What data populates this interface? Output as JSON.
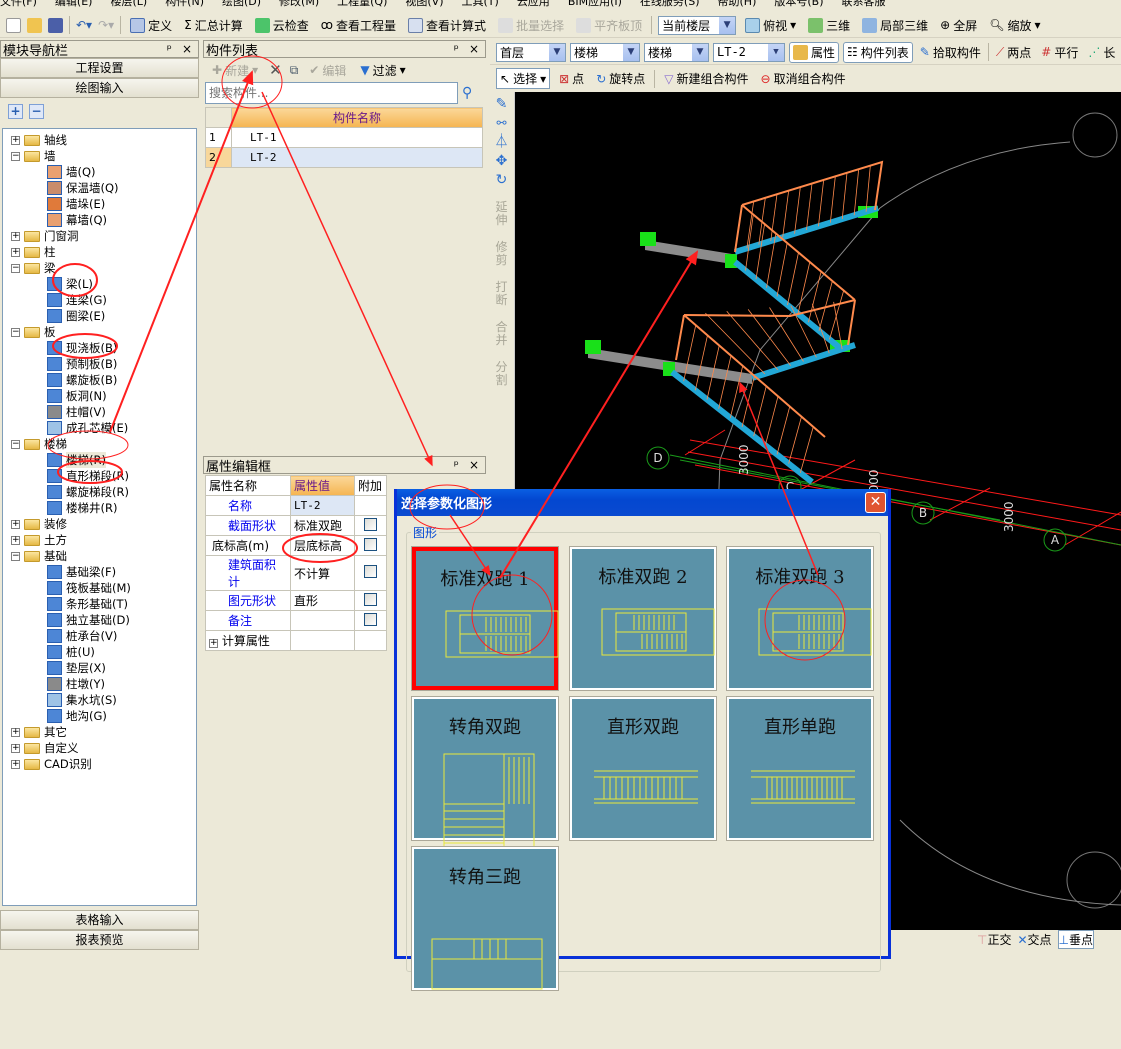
{
  "menu": [
    "文件(F)",
    "编辑(E)",
    "楼层(L)",
    "构件(N)",
    "绘图(D)",
    "修改(M)",
    "工程量(Q)",
    "视图(V)",
    "工具(T)",
    "云应用",
    "BIM应用(I)",
    "在线服务(S)",
    "帮助(H)",
    "版本号(B)",
    "联系客服"
  ],
  "toolbar1": {
    "define": "定义",
    "calc": "汇总计算",
    "cloud_check": "云检查",
    "view_qty": "查看工程量",
    "view_formula": "查看计算式",
    "batch_select": "批量选择",
    "align_top": "平齐板顶",
    "floor_select": "当前楼层",
    "top_view": "俯视",
    "three_d": "三维",
    "partial_3d": "局部三维",
    "fullscreen": "全屏",
    "zoom": "缩放"
  },
  "toolbar2": {
    "floor": "首层",
    "category": "楼梯",
    "type": "楼梯",
    "component": "LT-2",
    "properties": "属性",
    "component_list": "构件列表",
    "pick": "拾取构件",
    "two_points": "两点",
    "parallel": "平行",
    "length": "长"
  },
  "toolbar3": {
    "select": "选择",
    "point": "点",
    "rotate_point": "旋转点",
    "new_group": "新建组合构件",
    "cancel_group": "取消组合构件"
  },
  "vertical_toolbar": [
    "延伸",
    "修剪",
    "打断",
    "合并",
    "分割"
  ],
  "nav": {
    "title": "模块导航栏",
    "project_settings": "工程设置",
    "drawing_input": "绘图输入",
    "table_input": "表格输入",
    "report_preview": "报表预览",
    "tree": [
      {
        "label": "轴线",
        "level": 0,
        "state": "collapsed"
      },
      {
        "label": "墙",
        "level": 0,
        "state": "expanded"
      },
      {
        "label": "墙(Q)",
        "level": 1,
        "color": "#e9a070"
      },
      {
        "label": "保温墙(Q)",
        "level": 1,
        "color": "#c98c6c"
      },
      {
        "label": "墙垛(E)",
        "level": 1,
        "color": "#e07a3a"
      },
      {
        "label": "幕墙(Q)",
        "level": 1,
        "color": "#e9a070"
      },
      {
        "label": "门窗洞",
        "level": 0,
        "state": "collapsed"
      },
      {
        "label": "柱",
        "level": 0,
        "state": "collapsed"
      },
      {
        "label": "梁",
        "level": 0,
        "state": "expanded"
      },
      {
        "label": "梁(L)",
        "level": 1,
        "color": "#4d86d6"
      },
      {
        "label": "连梁(G)",
        "level": 1,
        "color": "#4d86d6"
      },
      {
        "label": "圈梁(E)",
        "level": 1,
        "color": "#4d86d6"
      },
      {
        "label": "板",
        "level": 0,
        "state": "expanded"
      },
      {
        "label": "现浇板(B)",
        "level": 1,
        "color": "#4d86d6"
      },
      {
        "label": "预制板(B)",
        "level": 1,
        "color": "#4d86d6"
      },
      {
        "label": "螺旋板(B)",
        "level": 1,
        "color": "#4d86d6"
      },
      {
        "label": "板洞(N)",
        "level": 1,
        "color": "#4d86d6"
      },
      {
        "label": "柱帽(V)",
        "level": 1,
        "color": "#8a8a8a"
      },
      {
        "label": "成孔芯模(E)",
        "level": 1,
        "color": "#9ec3e6"
      },
      {
        "label": "楼梯",
        "level": 0,
        "state": "expanded"
      },
      {
        "label": "楼梯(R)",
        "level": 1,
        "color": "#4d86d6",
        "selected": true
      },
      {
        "label": "直形梯段(R)",
        "level": 1,
        "color": "#4d86d6"
      },
      {
        "label": "螺旋梯段(R)",
        "level": 1,
        "color": "#4d86d6"
      },
      {
        "label": "楼梯井(R)",
        "level": 1,
        "color": "#4d86d6"
      },
      {
        "label": "装修",
        "level": 0,
        "state": "collapsed"
      },
      {
        "label": "土方",
        "level": 0,
        "state": "collapsed"
      },
      {
        "label": "基础",
        "level": 0,
        "state": "expanded"
      },
      {
        "label": "基础梁(F)",
        "level": 1,
        "color": "#4d86d6"
      },
      {
        "label": "筏板基础(M)",
        "level": 1,
        "color": "#4d86d6"
      },
      {
        "label": "条形基础(T)",
        "level": 1,
        "color": "#4d86d6"
      },
      {
        "label": "独立基础(D)",
        "level": 1,
        "color": "#4d86d6"
      },
      {
        "label": "桩承台(V)",
        "level": 1,
        "color": "#4d86d6"
      },
      {
        "label": "桩(U)",
        "level": 1,
        "color": "#4d86d6"
      },
      {
        "label": "垫层(X)",
        "level": 1,
        "color": "#4d86d6"
      },
      {
        "label": "柱墩(Y)",
        "level": 1,
        "color": "#8a8a8a"
      },
      {
        "label": "集水坑(S)",
        "level": 1,
        "color": "#9ec3e6"
      },
      {
        "label": "地沟(G)",
        "level": 1,
        "color": "#4d86d6"
      },
      {
        "label": "其它",
        "level": 0,
        "state": "collapsed"
      },
      {
        "label": "自定义",
        "level": 0,
        "state": "collapsed"
      },
      {
        "label": "CAD识别",
        "level": 0,
        "state": "collapsed"
      }
    ]
  },
  "component_list": {
    "title": "构件列表",
    "new": "新建",
    "edit": "编辑",
    "filter": "过滤",
    "search_placeholder": "搜索构件...",
    "column": "构件名称",
    "rows": [
      {
        "index": "1",
        "name": "LT-1"
      },
      {
        "index": "2",
        "name": "LT-2",
        "selected": true
      }
    ]
  },
  "property_editor": {
    "title": "属性编辑框",
    "headers": [
      "属性名称",
      "属性值",
      "附加"
    ],
    "rows": [
      {
        "name": "名称",
        "value": "LT-2",
        "blue": true,
        "checkbox": false
      },
      {
        "name": "截面形状",
        "value": "标准双跑",
        "blue": true,
        "checkbox": true
      },
      {
        "name": "底标高(m)",
        "value": "层底标高",
        "blue": false,
        "checkbox": true
      },
      {
        "name": "建筑面积计",
        "value": "不计算",
        "blue": true,
        "checkbox": true
      },
      {
        "name": "图元形状",
        "value": "直形",
        "blue": true,
        "checkbox": true
      },
      {
        "name": "备注",
        "value": "",
        "blue": true,
        "checkbox": true
      }
    ],
    "calc_group": "计算属性"
  },
  "canvas": {
    "axes": [
      "D",
      "C",
      "B",
      "A"
    ],
    "dimensions": [
      "3000",
      "3000",
      "3000"
    ]
  },
  "dialog": {
    "title": "选择参数化图形",
    "group": "图形",
    "tiles": [
      "标准双跑 1",
      "标准双跑 2",
      "标准双跑 3",
      "转角双跑",
      "直形双跑",
      "直形单跑",
      "转角三跑"
    ],
    "selected_index": 0
  },
  "status": {
    "ortho": "正交",
    "intersection": "交点",
    "perpendicular": "垂点"
  },
  "colors": {
    "canvas": "#000000",
    "stair": "#22a7d6",
    "railing": "#ff8a4c",
    "landing": "#8c8c8c",
    "support": "#19e019",
    "annotation": "#ff2020",
    "tile": "#5b92a8",
    "dialog_title": "#0a4ad0"
  }
}
